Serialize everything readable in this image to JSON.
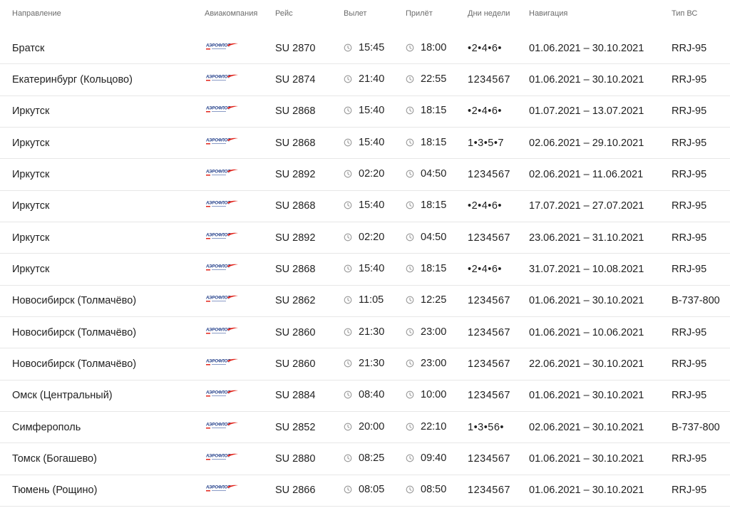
{
  "columns": {
    "destination": "Направление",
    "airline": "Авиакомпания",
    "flight": "Рейс",
    "departure": "Вылет",
    "arrival": "Прилёт",
    "weekdays": "Дни недели",
    "navigation": "Навигация",
    "aircraft": "Тип ВС"
  },
  "airline_logo": "aeroflot-logo",
  "colors": {
    "logo_blue": "#1f3c88",
    "logo_red": "#e2231a",
    "divider": "#e7e7e7",
    "header_text": "#6b6b6b"
  },
  "rows": [
    {
      "destination": "Братск",
      "flight": "SU 2870",
      "departure": "15:45",
      "arrival": "18:00",
      "weekdays": "•2•4•6•",
      "navigation": "01.06.2021 – 30.10.2021",
      "aircraft": "RRJ-95"
    },
    {
      "destination": "Екатеринбург (Кольцово)",
      "flight": "SU 2874",
      "departure": "21:40",
      "arrival": "22:55",
      "weekdays": "1234567",
      "navigation": "01.06.2021 – 30.10.2021",
      "aircraft": "RRJ-95"
    },
    {
      "destination": "Иркутск",
      "flight": "SU 2868",
      "departure": "15:40",
      "arrival": "18:15",
      "weekdays": "•2•4•6•",
      "navigation": "01.07.2021 – 13.07.2021",
      "aircraft": "RRJ-95"
    },
    {
      "destination": "Иркутск",
      "flight": "SU 2868",
      "departure": "15:40",
      "arrival": "18:15",
      "weekdays": "1•3•5•7",
      "navigation": "02.06.2021 – 29.10.2021",
      "aircraft": "RRJ-95"
    },
    {
      "destination": "Иркутск",
      "flight": "SU 2892",
      "departure": "02:20",
      "arrival": "04:50",
      "weekdays": "1234567",
      "navigation": "02.06.2021 – 11.06.2021",
      "aircraft": "RRJ-95"
    },
    {
      "destination": "Иркутск",
      "flight": "SU 2868",
      "departure": "15:40",
      "arrival": "18:15",
      "weekdays": "•2•4•6•",
      "navigation": "17.07.2021 – 27.07.2021",
      "aircraft": "RRJ-95"
    },
    {
      "destination": "Иркутск",
      "flight": "SU 2892",
      "departure": "02:20",
      "arrival": "04:50",
      "weekdays": "1234567",
      "navigation": "23.06.2021 – 31.10.2021",
      "aircraft": "RRJ-95"
    },
    {
      "destination": "Иркутск",
      "flight": "SU 2868",
      "departure": "15:40",
      "arrival": "18:15",
      "weekdays": "•2•4•6•",
      "navigation": "31.07.2021 – 10.08.2021",
      "aircraft": "RRJ-95"
    },
    {
      "destination": "Новосибирск (Толмачёво)",
      "flight": "SU 2862",
      "departure": "11:05",
      "arrival": "12:25",
      "weekdays": "1234567",
      "navigation": "01.06.2021 – 30.10.2021",
      "aircraft": "B-737-800"
    },
    {
      "destination": "Новосибирск (Толмачёво)",
      "flight": "SU 2860",
      "departure": "21:30",
      "arrival": "23:00",
      "weekdays": "1234567",
      "navigation": "01.06.2021 – 10.06.2021",
      "aircraft": "RRJ-95"
    },
    {
      "destination": "Новосибирск (Толмачёво)",
      "flight": "SU 2860",
      "departure": "21:30",
      "arrival": "23:00",
      "weekdays": "1234567",
      "navigation": "22.06.2021 – 30.10.2021",
      "aircraft": "RRJ-95"
    },
    {
      "destination": "Омск (Центральный)",
      "flight": "SU 2884",
      "departure": "08:40",
      "arrival": "10:00",
      "weekdays": "1234567",
      "navigation": "01.06.2021 – 30.10.2021",
      "aircraft": "RRJ-95"
    },
    {
      "destination": "Симферополь",
      "flight": "SU 2852",
      "departure": "20:00",
      "arrival": "22:10",
      "weekdays": "1•3•56•",
      "navigation": "02.06.2021 – 30.10.2021",
      "aircraft": "B-737-800"
    },
    {
      "destination": "Томск (Богашево)",
      "flight": "SU 2880",
      "departure": "08:25",
      "arrival": "09:40",
      "weekdays": "1234567",
      "navigation": "01.06.2021 – 30.10.2021",
      "aircraft": "RRJ-95"
    },
    {
      "destination": "Тюмень (Рощино)",
      "flight": "SU 2866",
      "departure": "08:05",
      "arrival": "08:50",
      "weekdays": "1234567",
      "navigation": "01.06.2021 – 30.10.2021",
      "aircraft": "RRJ-95"
    }
  ]
}
